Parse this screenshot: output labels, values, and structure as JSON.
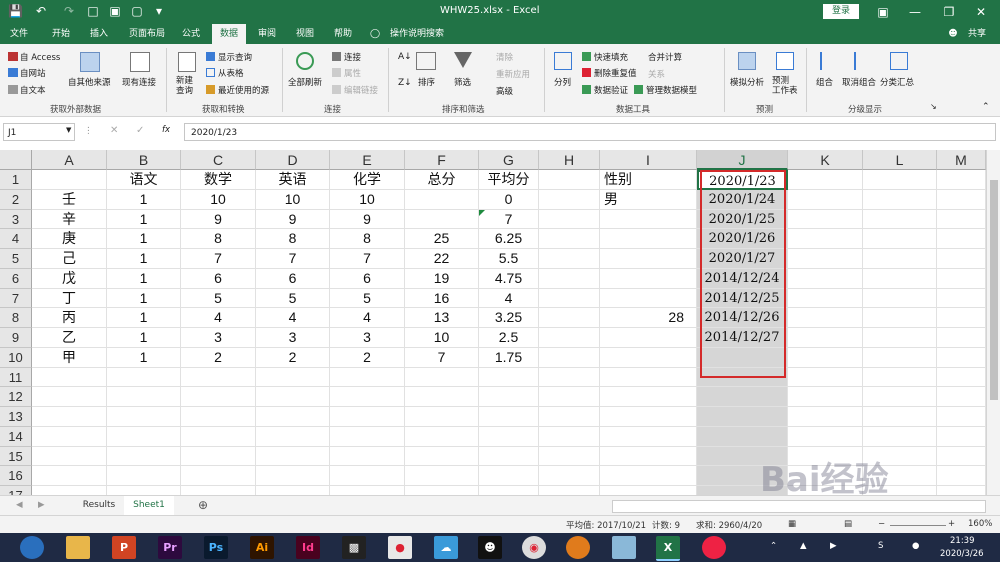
{
  "window": {
    "title": "WHW25.xlsx  -  Excel",
    "login_label": "登录",
    "share_label": "共享"
  },
  "menu": [
    "文件",
    "开始",
    "插入",
    "页面布局",
    "公式",
    "数据",
    "审阅",
    "视图",
    "帮助",
    "操作说明搜索"
  ],
  "ribbon": {
    "get_external": {
      "access": "自 Access",
      "web": "自网站",
      "text": "自文本",
      "other": "自其他来源",
      "existing": "现有连接",
      "group": "获取外部数据"
    },
    "get_transform": {
      "new_query": "新建\n查询",
      "show_queries": "显示查询",
      "from_table": "从表格",
      "recent_sources": "最近使用的源",
      "group": "获取和转换"
    },
    "connections": {
      "refresh_all": "全部刷新",
      "connections": "连接",
      "properties": "属性",
      "edit_links": "编辑链接",
      "group": "连接"
    },
    "sort_filter": {
      "sort": "排序",
      "filter": "筛选",
      "clear": "清除",
      "reapply": "重新应用",
      "advanced": "高级",
      "group": "排序和筛选"
    },
    "data_tools": {
      "text_to_columns": "分列",
      "flash_fill": "快速填充",
      "remove_duplicates": "删除重复值",
      "data_validation": "数据验证",
      "consolidate": "合并计算",
      "relationships": "关系",
      "manage_model": "管理数据模型",
      "group": "数据工具"
    },
    "forecast": {
      "what_if": "模拟分析",
      "forecast_sheet": "预测\n工作表",
      "group": "预测"
    },
    "outline": {
      "group_btn": "组合",
      "ungroup": "取消组合",
      "subtotal": "分类汇总",
      "group": "分级显示"
    }
  },
  "formula_bar": {
    "name_box": "J1",
    "fx": "fx",
    "value": "2020/1/23"
  },
  "columns": [
    "A",
    "B",
    "C",
    "D",
    "E",
    "F",
    "G",
    "H",
    "I",
    "J",
    "K",
    "L",
    "M"
  ],
  "rows": [
    [
      "",
      "语文",
      "数学",
      "英语",
      "化学",
      "总分",
      "平均分",
      "",
      "性别",
      "2020/1/23",
      "",
      "",
      ""
    ],
    [
      "壬",
      "1",
      "10",
      "10",
      "10",
      "",
      "0",
      "",
      "男",
      "2020/1/24",
      "",
      "",
      ""
    ],
    [
      "辛",
      "1",
      "9",
      "9",
      "9",
      "",
      "7",
      "",
      "",
      "2020/1/25",
      "",
      "",
      ""
    ],
    [
      "庚",
      "1",
      "8",
      "8",
      "8",
      "25",
      "6.25",
      "",
      "",
      "2020/1/26",
      "",
      "",
      ""
    ],
    [
      "己",
      "1",
      "7",
      "7",
      "7",
      "22",
      "5.5",
      "",
      "",
      "2020/1/27",
      "",
      "",
      ""
    ],
    [
      "戊",
      "1",
      "6",
      "6",
      "6",
      "19",
      "4.75",
      "",
      "",
      "2014/12/24",
      "",
      "",
      ""
    ],
    [
      "丁",
      "1",
      "5",
      "5",
      "5",
      "16",
      "4",
      "",
      "",
      "2014/12/25",
      "",
      "",
      ""
    ],
    [
      "丙",
      "1",
      "4",
      "4",
      "4",
      "13",
      "3.25",
      "",
      "28",
      "2014/12/26",
      "",
      "",
      ""
    ],
    [
      "乙",
      "1",
      "3",
      "3",
      "3",
      "10",
      "2.5",
      "",
      "",
      "2014/12/27",
      "",
      "",
      ""
    ],
    [
      "甲",
      "1",
      "2",
      "2",
      "2",
      "7",
      "1.75",
      "",
      "",
      "",
      "",
      "",
      ""
    ],
    [
      "",
      "",
      "",
      "",
      "",
      "",
      "",
      "",
      "",
      "",
      "",
      "",
      ""
    ],
    [
      "",
      "",
      "",
      "",
      "",
      "",
      "",
      "",
      "",
      "",
      "",
      "",
      ""
    ],
    [
      "",
      "",
      "",
      "",
      "",
      "",
      "",
      "",
      "",
      "",
      "",
      "",
      ""
    ],
    [
      "",
      "",
      "",
      "",
      "",
      "",
      "",
      "",
      "",
      "",
      "",
      "",
      ""
    ],
    [
      "",
      "",
      "",
      "",
      "",
      "",
      "",
      "",
      "",
      "",
      "",
      "",
      ""
    ],
    [
      "",
      "",
      "",
      "",
      "",
      "",
      "",
      "",
      "",
      "",
      "",
      "",
      ""
    ],
    [
      "",
      "",
      "",
      "",
      "",
      "",
      "",
      "",
      "",
      "",
      "",
      "",
      ""
    ]
  ],
  "row_numbers": [
    "1",
    "2",
    "3",
    "4",
    "5",
    "6",
    "7",
    "8",
    "9",
    "10",
    "11",
    "12",
    "13",
    "14",
    "15",
    "16",
    "17"
  ],
  "sheet_tabs": [
    "Results",
    "Sheet1"
  ],
  "status": {
    "average": "平均值: 2017/10/21",
    "count": "计数: 9",
    "sum": "求和: 2960/4/20",
    "zoom": "160%"
  },
  "taskbar": {
    "time": "21:39",
    "date": "2020/3/26"
  },
  "watermark": "Bai经验",
  "colors": {
    "excel_green": "#217346",
    "highlight_red": "#d42a2a",
    "selected_col": "#d6d6d6"
  }
}
